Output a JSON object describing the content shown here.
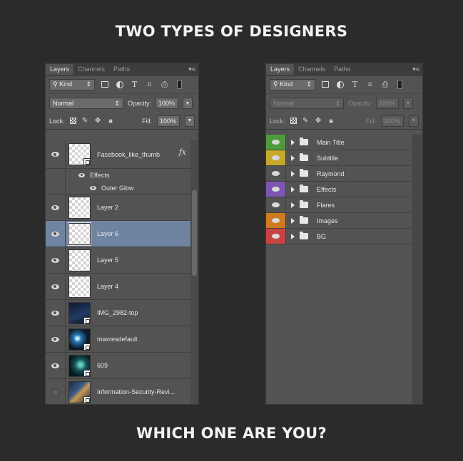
{
  "headline_top": "TWO TYPES OF DESIGNERS",
  "headline_bottom": "WHICH ONE ARE YOU?",
  "panel_common": {
    "tabs": [
      "Layers",
      "Channels",
      "Paths"
    ],
    "kind_label": "Kind",
    "filter_icons": [
      "image-filter-icon",
      "adjustment-filter-icon",
      "type-filter-icon",
      "shape-filter-icon",
      "smart-object-filter-icon"
    ],
    "blend_mode": "Normal",
    "opacity_label": "Opacity:",
    "opacity_value": "100%",
    "lock_label": "Lock:",
    "fill_label": "Fill:",
    "fill_value": "100%"
  },
  "left_panel": {
    "layers": [
      {
        "name": "Facebook_like_thumb",
        "visible": true,
        "thumb": "transparent",
        "fx": "fx"
      },
      {
        "name": "Layer 2",
        "visible": true,
        "thumb": "transparent"
      },
      {
        "name": "Layer 6",
        "visible": true,
        "thumb": "transparent",
        "selected": true
      },
      {
        "name": "Layer 5",
        "visible": true,
        "thumb": "transparent"
      },
      {
        "name": "Layer 4",
        "visible": true,
        "thumb": "transparent"
      },
      {
        "name": "IMG_2982-top",
        "visible": true,
        "thumb": "photo"
      },
      {
        "name": "maxresdefault",
        "visible": true,
        "thumb": "photo"
      },
      {
        "name": "609",
        "visible": true,
        "thumb": "photo"
      },
      {
        "name": "Information-Security-Revi...",
        "visible": false,
        "thumb": "photo"
      }
    ],
    "effects_label": "Effects",
    "effect_items": [
      "Outer Glow"
    ]
  },
  "right_panel": {
    "groups": [
      {
        "name": "Main Title",
        "color": "#4f9a3c"
      },
      {
        "name": "Subtitle",
        "color": "#c6a92b"
      },
      {
        "name": "Raymond",
        "color": "#555555"
      },
      {
        "name": "Effects",
        "color": "#7d55b2"
      },
      {
        "name": "Flares",
        "color": "#555555"
      },
      {
        "name": "Images",
        "color": "#cf7a22"
      },
      {
        "name": "BG",
        "color": "#c84444"
      }
    ]
  }
}
